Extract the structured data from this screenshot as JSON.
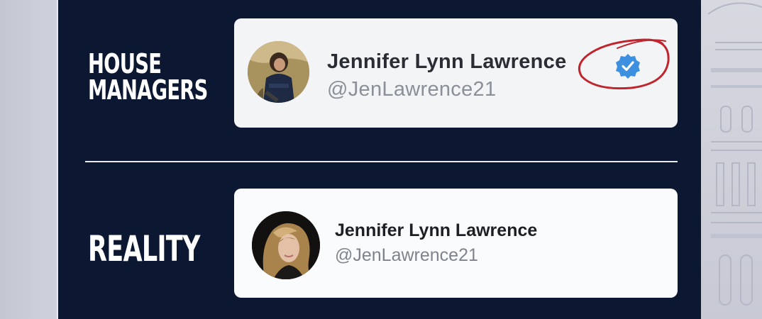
{
  "labels": {
    "top_line1": "HOUSE",
    "top_line2": "MANAGERS",
    "bottom": "REALITY"
  },
  "profiles": [
    {
      "name": "Jennifer Lynn Lawrence",
      "handle": "@JenLawrence21",
      "verified": true,
      "annotation": "red-hand-drawn-circle"
    },
    {
      "name": "Jennifer Lynn Lawrence",
      "handle": "@JenLawrence21",
      "verified": false
    }
  ],
  "colors": {
    "panel": "#0c1731",
    "card": "#f3f4f6",
    "verified_badge": "#3d8fe0",
    "annotation": "#c0242c"
  },
  "icons": {
    "verified": "verified-badge-icon",
    "annotation": "red-circle-annotation"
  }
}
